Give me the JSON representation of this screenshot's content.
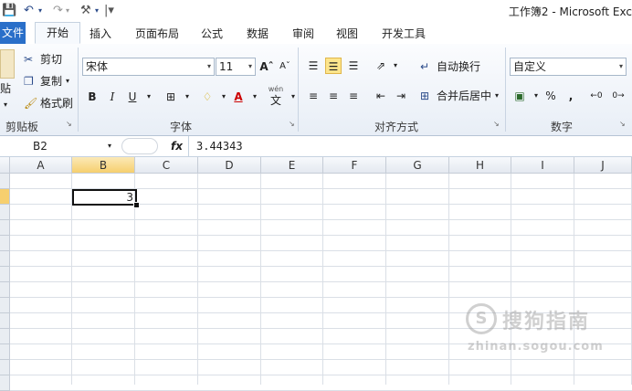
{
  "window": {
    "title": "工作簿2 - Microsoft Exc"
  },
  "tabs": {
    "file": "文件",
    "home": "开始",
    "insert": "插入",
    "page_layout": "页面布局",
    "formulas": "公式",
    "data": "数据",
    "review": "审阅",
    "view": "视图",
    "developer": "开发工具"
  },
  "clipboard": {
    "paste": "贴",
    "cut": "剪切",
    "copy": "复制",
    "format_painter": "格式刷",
    "label": "剪贴板"
  },
  "font": {
    "name": "宋体",
    "size": "11",
    "bold": "B",
    "italic": "I",
    "underline": "U",
    "label": "字体",
    "wen": "wén",
    "phonetic_char": "文"
  },
  "alignment": {
    "wrap_text": "自动换行",
    "merge_center": "合并后居中",
    "label": "对齐方式"
  },
  "number": {
    "format": "自定义",
    "percent": "%",
    "comma": ",",
    "label": "数字"
  },
  "formula_bar": {
    "name_box": "B2",
    "fx": "fx",
    "value": "3.44343"
  },
  "grid": {
    "columns": [
      "A",
      "B",
      "C",
      "D",
      "E",
      "F",
      "G",
      "H",
      "I",
      "J"
    ],
    "selected_column": "B",
    "active_cell_value": "3"
  },
  "watermark": {
    "logo_char": "S",
    "text": "搜狗指南",
    "url": "zhinan.sogou.com"
  },
  "colors": {
    "file_tab": "#2a6fc9",
    "selection_header": "#f6cf6e",
    "active_align": "#fde58c"
  }
}
